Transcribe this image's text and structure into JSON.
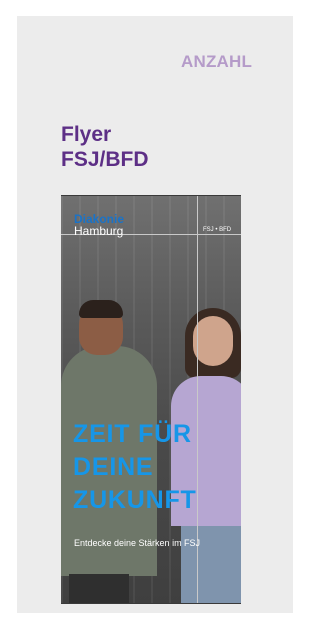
{
  "header": {
    "label": "ANZAHL"
  },
  "product": {
    "title_line1": "Flyer",
    "title_line2": "FSJ/BFD"
  },
  "flyer": {
    "brand_line1": "Diakonie",
    "brand_line2": "Hamburg",
    "tag": "FSJ • BFD",
    "headline_line1": "ZEIT FÜR",
    "headline_line2": "DEINE",
    "headline_line3": "ZUKUNFT",
    "subtitle": "Entdecke deine Stärken im FSJ"
  }
}
